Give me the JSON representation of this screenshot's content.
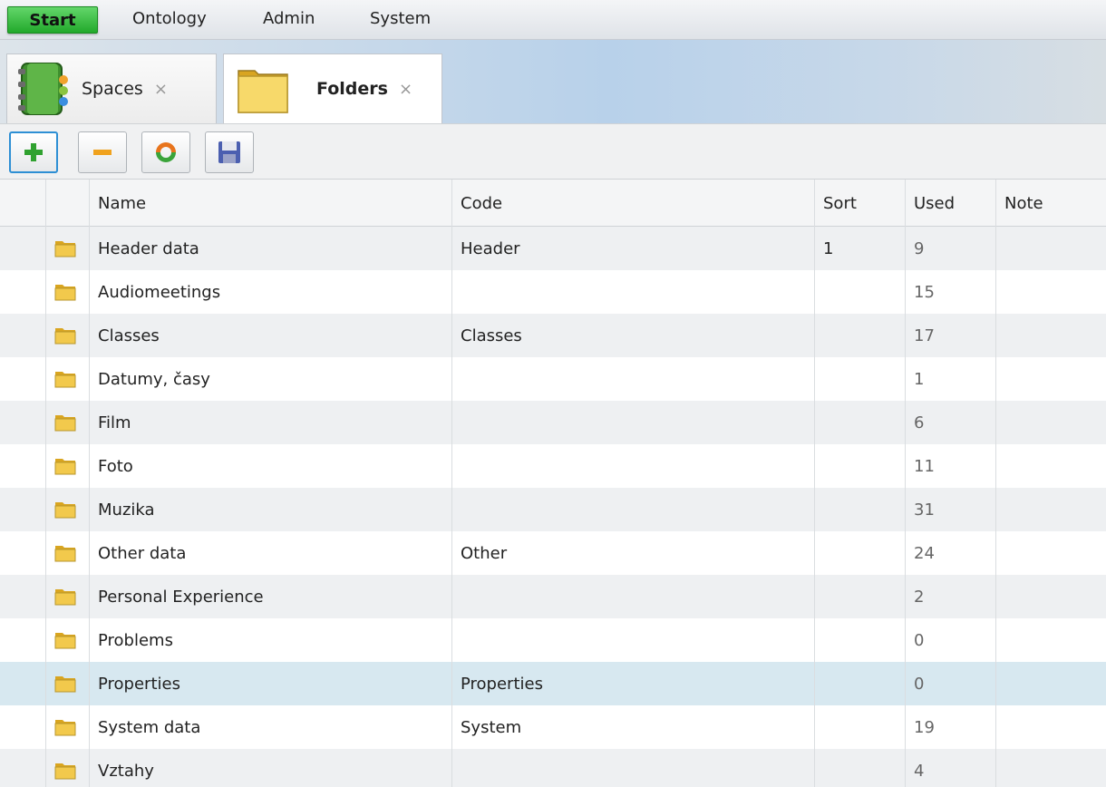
{
  "menu": {
    "start_label": "Start",
    "items": [
      "Ontology",
      "Admin",
      "System"
    ]
  },
  "tabs": [
    {
      "label": "Spaces",
      "close": "×",
      "icon": "address-book-icon"
    },
    {
      "label": "Folders",
      "close": "×",
      "icon": "folder-icon",
      "active": true
    }
  ],
  "toolbar": {
    "buttons": [
      {
        "name": "add-button",
        "icon": "plus-icon"
      },
      {
        "name": "remove-button",
        "icon": "minus-icon"
      },
      {
        "name": "refresh-button",
        "icon": "refresh-icon"
      },
      {
        "name": "save-button",
        "icon": "floppy-disk-icon"
      }
    ]
  },
  "grid": {
    "columns": [
      "Name",
      "Code",
      "Sort",
      "Used",
      "Note"
    ],
    "rows": [
      {
        "name": "Header data",
        "code": "Header",
        "sort": "1",
        "used": "9",
        "note": ""
      },
      {
        "name": "Audiomeetings",
        "code": "",
        "sort": "",
        "used": "15",
        "note": ""
      },
      {
        "name": "Classes",
        "code": "Classes",
        "sort": "",
        "used": "17",
        "note": ""
      },
      {
        "name": "Datumy, časy",
        "code": "",
        "sort": "",
        "used": "1",
        "note": ""
      },
      {
        "name": "Film",
        "code": "",
        "sort": "",
        "used": "6",
        "note": ""
      },
      {
        "name": "Foto",
        "code": "",
        "sort": "",
        "used": "11",
        "note": ""
      },
      {
        "name": "Muzika",
        "code": "",
        "sort": "",
        "used": "31",
        "note": ""
      },
      {
        "name": "Other data",
        "code": "Other",
        "sort": "",
        "used": "24",
        "note": ""
      },
      {
        "name": "Personal Experience",
        "code": "",
        "sort": "",
        "used": "2",
        "note": ""
      },
      {
        "name": "Problems",
        "code": "",
        "sort": "",
        "used": "0",
        "note": ""
      },
      {
        "name": "Properties",
        "code": "Properties",
        "sort": "",
        "used": "0",
        "note": "",
        "selected": true
      },
      {
        "name": "System data",
        "code": "System",
        "sort": "",
        "used": "19",
        "note": ""
      },
      {
        "name": "Vztahy",
        "code": "",
        "sort": "",
        "used": "4",
        "note": ""
      }
    ]
  },
  "colors": {
    "start_green": "#22a92b",
    "selected_row": "#d7e8f0",
    "folder_yellow": "#f2c94c"
  }
}
